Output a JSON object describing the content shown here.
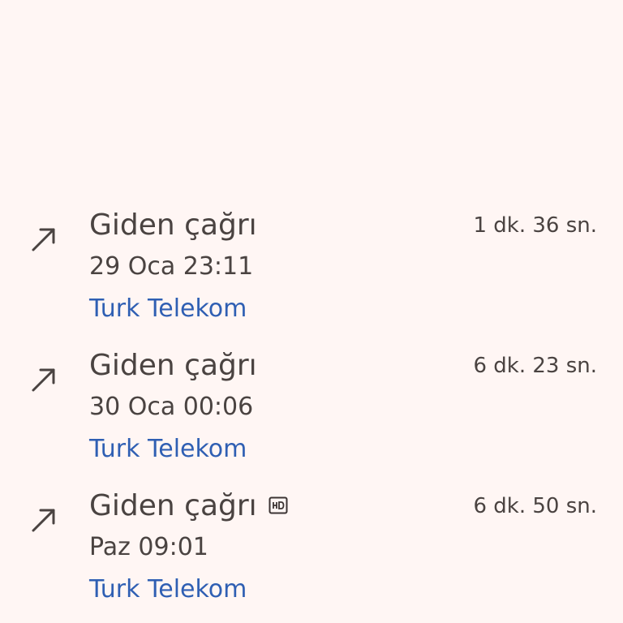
{
  "calls": [
    {
      "icon": "outgoing-call-arrow-icon",
      "title": "Giden çağrı",
      "hd": false,
      "duration": "1 dk. 36 sn.",
      "datetime": "29 Oca 23:11",
      "carrier": "Turk Telekom"
    },
    {
      "icon": "outgoing-call-arrow-icon",
      "title": "Giden çağrı",
      "hd": false,
      "duration": "6 dk. 23 sn.",
      "datetime": "30 Oca 00:06",
      "carrier": "Turk Telekom"
    },
    {
      "icon": "outgoing-call-arrow-icon",
      "title": "Giden çağrı",
      "hd": true,
      "hd_icon": "hd-voice-icon",
      "duration": "6 dk. 50 sn.",
      "datetime": "Paz 09:01",
      "carrier": "Turk Telekom"
    }
  ],
  "colors": {
    "background": "#fff6f4",
    "text": "#4a4341",
    "carrier": "#2f5fb3"
  }
}
